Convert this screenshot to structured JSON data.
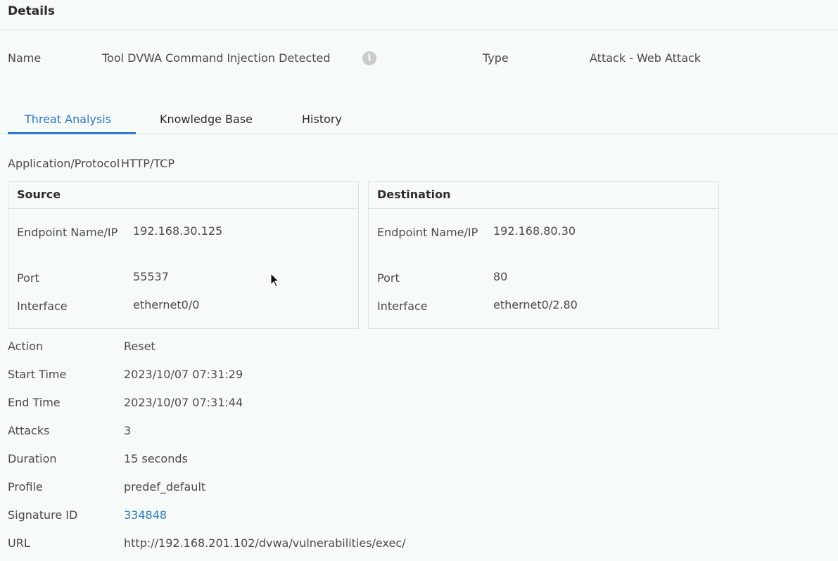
{
  "header": {
    "title": "Details"
  },
  "summary": {
    "name_label": "Name",
    "name_value": "Tool DVWA Command Injection Detected",
    "type_label": "Type",
    "type_value": "Attack - Web Attack"
  },
  "tabs": [
    {
      "label": "Threat Analysis",
      "active": true
    },
    {
      "label": "Knowledge Base",
      "active": false
    },
    {
      "label": "History",
      "active": false
    }
  ],
  "protocol": {
    "label": "Application/Protocol",
    "value": "HTTP/TCP"
  },
  "source": {
    "title": "Source",
    "endpoint_label": "Endpoint Name/IP",
    "endpoint_value": "192.168.30.125",
    "port_label": "Port",
    "port_value": "55537",
    "interface_label": "Interface",
    "interface_value": "ethernet0/0"
  },
  "destination": {
    "title": "Destination",
    "endpoint_label": "Endpoint Name/IP",
    "endpoint_value": "192.168.80.30",
    "port_label": "Port",
    "port_value": "80",
    "interface_label": "Interface",
    "interface_value": "ethernet0/2.80"
  },
  "details": {
    "action_label": "Action",
    "action_value": "Reset",
    "start_label": "Start Time",
    "start_value": "2023/10/07 07:31:29",
    "end_label": "End Time",
    "end_value": "2023/10/07 07:31:44",
    "attacks_label": "Attacks",
    "attacks_value": "3",
    "duration_label": "Duration",
    "duration_value": "15 seconds",
    "profile_label": "Profile",
    "profile_value": "predef_default",
    "signature_label": "Signature ID",
    "signature_value": "334848",
    "url_label": "URL",
    "url_value": "http://192.168.201.102/dvwa/vulnerabilities/exec/"
  },
  "icons": {
    "info": "info-icon",
    "cursor": "mouse-cursor-icon"
  },
  "colors": {
    "accent": "#2a79c9",
    "background": "#f6faf8",
    "border": "#dde3e0"
  }
}
